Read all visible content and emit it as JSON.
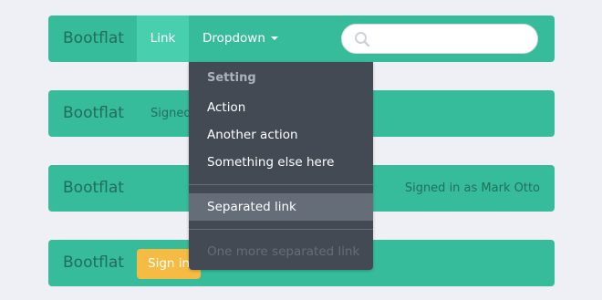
{
  "navbar1": {
    "brand": "Bootflat",
    "link_label": "Link",
    "dropdown_label": "Dropdown",
    "search": {
      "value": "",
      "placeholder": ""
    }
  },
  "navbar2": {
    "brand": "Bootflat",
    "text": "Signed in as Mark Otto"
  },
  "navbar3": {
    "brand": "Bootflat",
    "text": "Signed in as Mark Otto"
  },
  "navbar4": {
    "brand": "Bootflat",
    "button_label": "Sign in"
  },
  "dropdown_menu": {
    "header": "Setting",
    "items": [
      {
        "label": "Action"
      },
      {
        "label": "Another action"
      },
      {
        "label": "Something else here"
      }
    ],
    "separated_item": "Separated link",
    "disabled_item": "One more separated link"
  },
  "colors": {
    "page_bg": "#eff0f5",
    "navbar_bg": "#37bc9b",
    "link_active_bg": "#48cfad",
    "dropdown_bg": "#434a54",
    "dropdown_active_bg": "#656d78",
    "button_warning": "#f6bb42"
  },
  "icons": {
    "search": "search-icon",
    "dropdown_caret": "caret-down-icon"
  }
}
